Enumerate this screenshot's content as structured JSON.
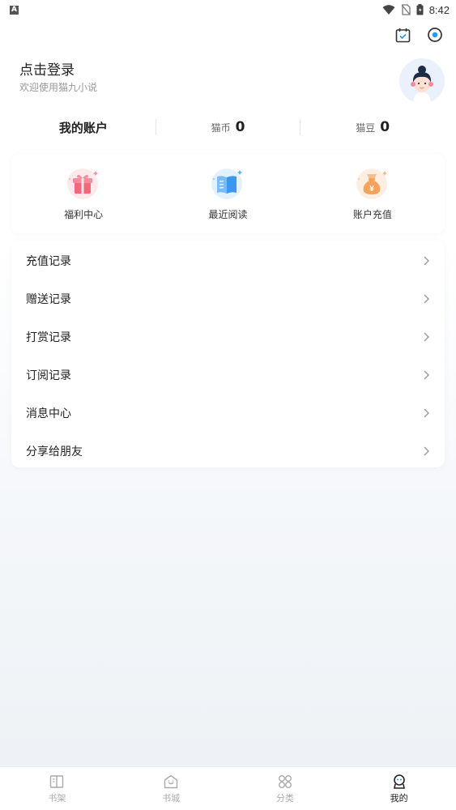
{
  "status_bar": {
    "time": "8:42",
    "icons": [
      "a-icon",
      "wifi-icon",
      "no-sim-icon",
      "battery-icon"
    ]
  },
  "top_actions": {
    "icons": [
      "calendar-check-icon",
      "settings-icon"
    ]
  },
  "profile": {
    "title": "点击登录",
    "subtitle": "欢迎使用猫九小说"
  },
  "account": {
    "title": "我的账户",
    "coin_label": "猫币",
    "coin_value": "0",
    "bean_label": "猫豆",
    "bean_value": "0"
  },
  "quick_actions": [
    {
      "label": "福利中心",
      "icon": "gift-icon",
      "color": "#f3677d"
    },
    {
      "label": "最近阅读",
      "icon": "book-icon",
      "color": "#4da3f5"
    },
    {
      "label": "账户充值",
      "icon": "money-bag-icon",
      "color": "#f5a35c"
    }
  ],
  "menu": [
    {
      "label": "充值记录"
    },
    {
      "label": "赠送记录"
    },
    {
      "label": "打赏记录"
    },
    {
      "label": "订阅记录"
    },
    {
      "label": "消息中心"
    },
    {
      "label": "分享给朋友"
    }
  ],
  "tabs": [
    {
      "label": "书架",
      "icon": "bookshelf-icon",
      "active": false
    },
    {
      "label": "书城",
      "icon": "store-icon",
      "active": false
    },
    {
      "label": "分类",
      "icon": "category-icon",
      "active": false
    },
    {
      "label": "我的",
      "icon": "profile-icon",
      "active": true
    }
  ],
  "colors": {
    "accent": "#1d9bf0",
    "text_primary": "#222222",
    "text_secondary": "#999999"
  }
}
